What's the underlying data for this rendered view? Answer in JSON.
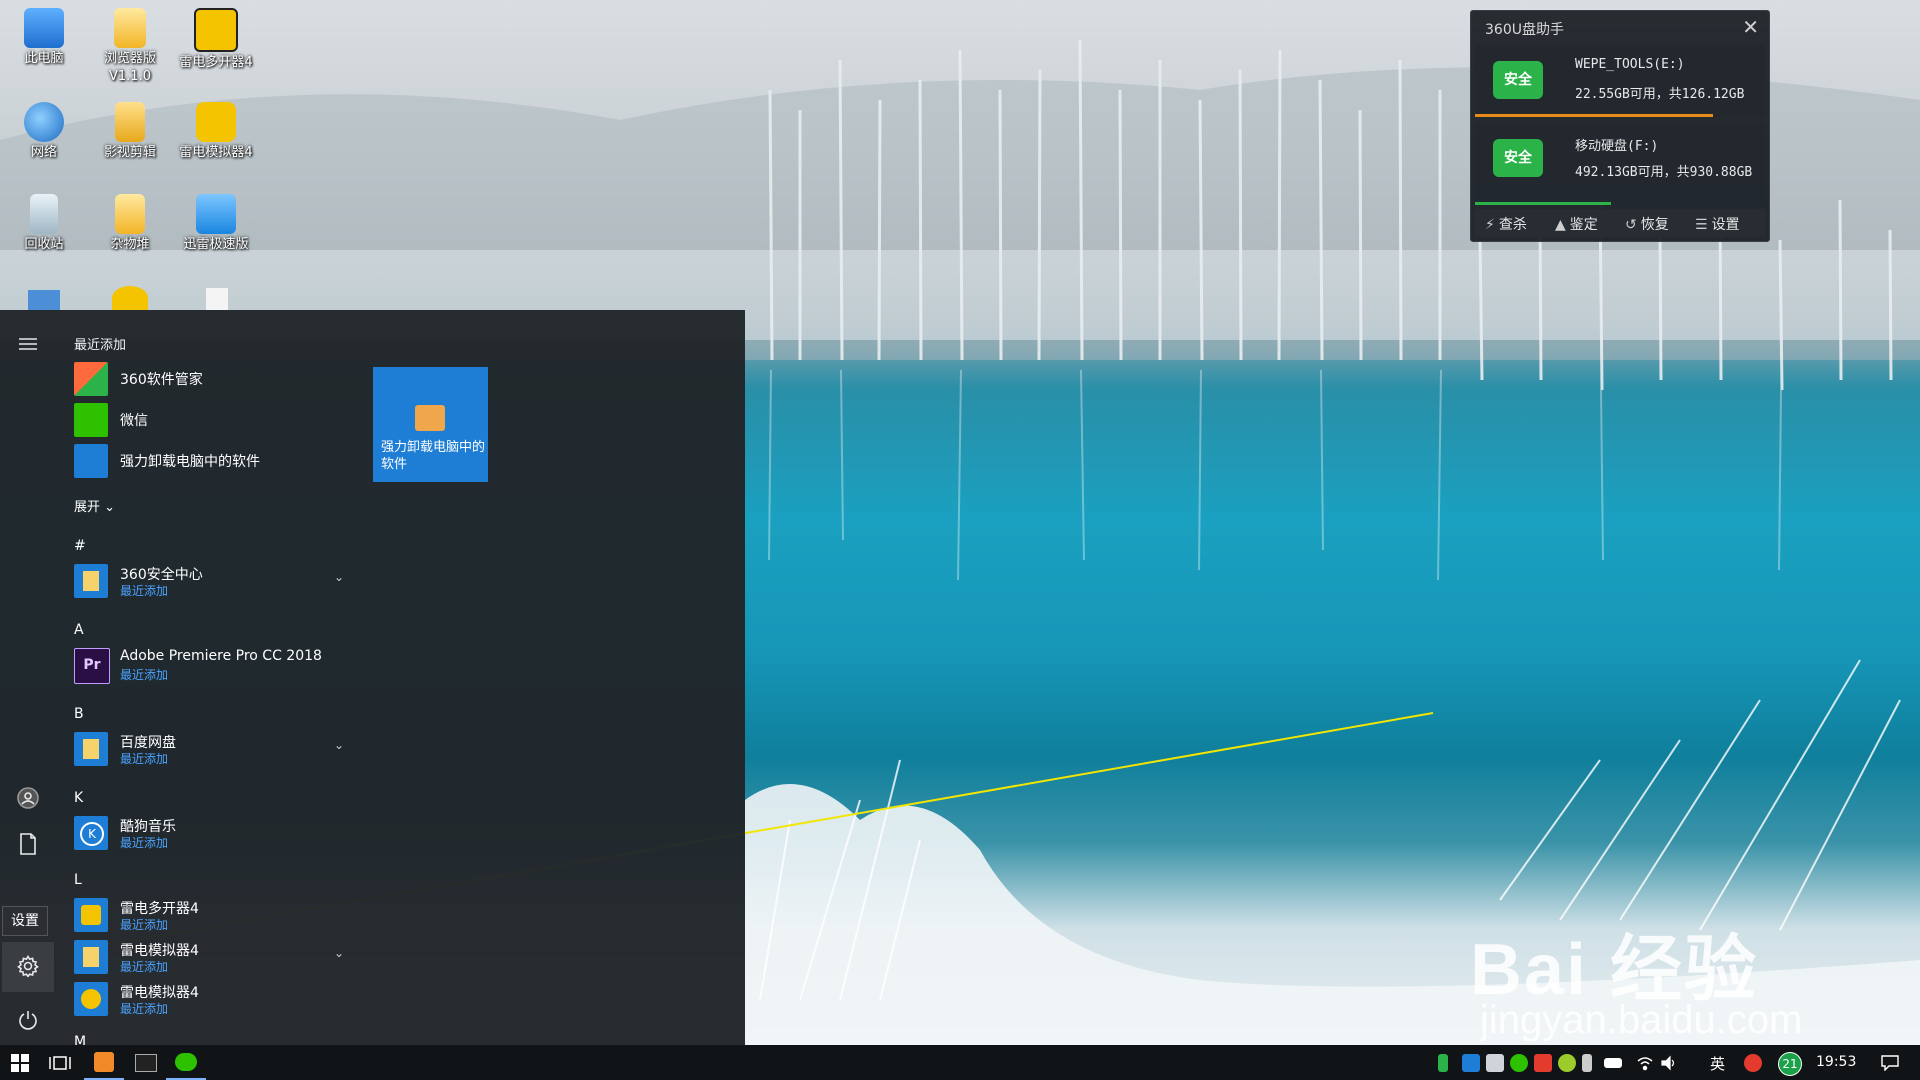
{
  "desktop": {
    "icons": [
      {
        "label": "此电脑"
      },
      {
        "label": "浏览器版\nV1.1.0"
      },
      {
        "label": "雷电多开器4"
      },
      {
        "label": "网络"
      },
      {
        "label": "影视剪辑"
      },
      {
        "label": "雷电模拟器4"
      },
      {
        "label": "回收站"
      },
      {
        "label": "杂物堆"
      },
      {
        "label": "迅雷极速版"
      }
    ]
  },
  "usb_widget": {
    "title": "360U盘助手",
    "close": "✕",
    "drives": [
      {
        "badge": "安全",
        "name": "WEPE_TOOLS(E:)",
        "capacity": "22.55GB可用，共126.12GB",
        "used_fraction": 0.82,
        "bar_color": "#e88a1a"
      },
      {
        "badge": "安全",
        "name": "移动硬盘(F:)",
        "capacity": "492.13GB可用，共930.88GB",
        "used_fraction": 0.47,
        "bar_color": "#2bb34a"
      }
    ],
    "tools": [
      {
        "icon": "⚡",
        "label": "查杀"
      },
      {
        "icon": "▲",
        "label": "鉴定"
      },
      {
        "icon": "↺",
        "label": "恢复"
      },
      {
        "icon": "☰",
        "label": "设置"
      }
    ]
  },
  "start_menu": {
    "recent_header": "最近添加",
    "recent_apps": [
      {
        "name": "360软件管家"
      },
      {
        "name": "微信"
      },
      {
        "name": "强力卸载电脑中的软件"
      }
    ],
    "expand_label": "展开",
    "tile_label": "强力卸载电脑中的软件",
    "groups": [
      {
        "letter": "#",
        "app": {
          "name": "360安全中心",
          "sub": "最近添加",
          "expandable": true
        }
      },
      {
        "letter": "A",
        "app": {
          "name": "Adobe Premiere Pro CC 2018",
          "sub": "最近添加",
          "expandable": false
        }
      },
      {
        "letter": "B",
        "app": {
          "name": "百度网盘",
          "sub": "最近添加",
          "expandable": true
        }
      },
      {
        "letter": "K",
        "app": {
          "name": "酷狗音乐",
          "sub": "最近添加",
          "expandable": false
        }
      },
      {
        "letter": "L",
        "apps": [
          {
            "name": "雷电多开器4",
            "sub": "最近添加",
            "expandable": false
          },
          {
            "name": "雷电模拟器4",
            "sub": "最近添加",
            "expandable": true
          },
          {
            "name": "雷电模拟器4",
            "sub": "最近添加",
            "expandable": false
          }
        ]
      },
      {
        "letter": "M"
      }
    ],
    "settings_tooltip": "设置"
  },
  "taskbar": {
    "clock": "19:53",
    "ime": "英",
    "notification_count": "21"
  },
  "watermark": {
    "brand": "Bai  经验",
    "url": "jingyan.baidu.com"
  }
}
